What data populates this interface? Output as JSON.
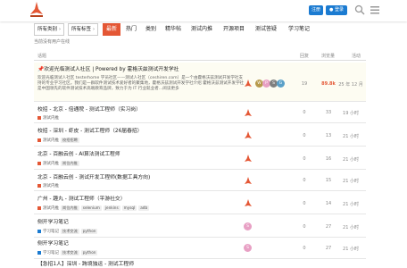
{
  "header": {
    "signup_label": "注册",
    "login_label": "登录",
    "login_icon": "person-icon",
    "search_icon": "search-icon",
    "menu_icon": "hamburger-menu-icon",
    "accent": "#1b7bd1"
  },
  "nav": {
    "category_dropdown": "所有类别",
    "tag_dropdown": "所有标签",
    "tabs": [
      "最新",
      "热门",
      "类别",
      "精华帖",
      "测试内推",
      "开源项目",
      "测试答疑",
      "学习笔记"
    ],
    "active_tab": "最新",
    "active_color": "#e45735"
  },
  "banner": "当前没有用户在线",
  "table": {
    "headers": {
      "topic": "话题",
      "replies": "回复",
      "views": "浏览量",
      "activity": "活动"
    }
  },
  "topics": [
    {
      "title": "欢迎光临测试人社区 | Powered by 霍格沃兹测试开发学社",
      "excerpt": "欢迎光临测试人社区 testerhome 学员社区——测试人社区（ceshiren.com）是一个由霍格沃兹测试开发学社支持的专业学习社区。我们是一群软件测试技术爱好者的聚集地，霍格沃兹测试开发学社介绍 霍格沃兹测试开发学社是中国领先的软件测试技术高端教育品牌，致力于为 IT 行业就业者…阅读更多",
      "replies": "19",
      "views": "89.8k",
      "activity": "25 年 12 月",
      "pinned": true
    },
    {
      "title": "校招 - 北京 - 倍通院 - 测试工程师（实习岗）",
      "category": "测试内推",
      "tags": [],
      "replies": "0",
      "views": "33",
      "activity": "19 小时"
    },
    {
      "title": "校招 - 深圳 - 虾皮 - 测试工程师（26届春招）",
      "category": "测试内推",
      "tags": [
        "校招招聘"
      ],
      "replies": "0",
      "views": "13",
      "activity": "21 小时"
    },
    {
      "title": "北京 - 百融云创 - AI算法测试工程师",
      "category": "测试内推",
      "tags": [
        "岗位内推"
      ],
      "replies": "0",
      "views": "16",
      "activity": "21 小时"
    },
    {
      "title": "北京 - 百融云创 - 测试开发工程师(数据工具方向)",
      "category": "测试内推",
      "tags": [],
      "replies": "0",
      "views": "15",
      "activity": "21 小时"
    },
    {
      "title": "广州 - 趣丸 - 测试工程师（平游社交）",
      "category": "测试内推",
      "tags": [
        "岗位内推",
        "selenium",
        "jenkins",
        "mysql",
        "adb"
      ],
      "replies": "0",
      "views": "14",
      "activity": "21 小时"
    },
    {
      "title": "侧开学习笔记",
      "category": "学习笔记",
      "tags": [
        "技术交流",
        "python"
      ],
      "replies": "0",
      "views": "27",
      "activity": "21 小时"
    },
    {
      "title": "侧开学习笔记",
      "category": "学习笔记",
      "tags": [
        "技术交流",
        "python"
      ],
      "replies": "0",
      "views": "27",
      "activity": "21 小时"
    },
    {
      "title": "【急招1人】深圳 - 跨境独运 - 测试工程师",
      "category": "",
      "tags": [],
      "replies": "",
      "views": "",
      "activity": ""
    }
  ]
}
